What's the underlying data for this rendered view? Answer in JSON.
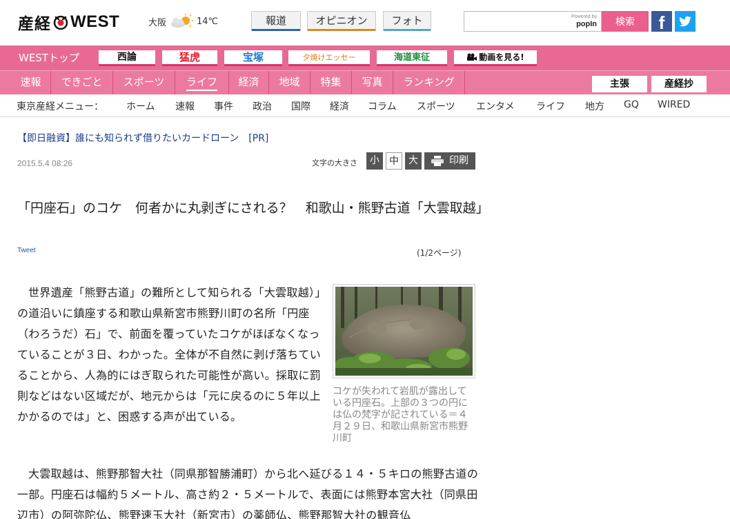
{
  "header": {
    "logo_jp": "産経",
    "logo_en": "WEST",
    "weather": {
      "city": "大阪",
      "icon": "sun-cloud-icon",
      "temp": "14℃"
    },
    "buttons": {
      "news": "報道",
      "opinion": "オピニオン",
      "photo": "フォト"
    },
    "search": {
      "placeholder": "",
      "powered_by": "Powered by",
      "provider": "popIn",
      "button": "検索"
    },
    "social": {
      "facebook": "f",
      "twitter": "twitter-icon"
    }
  },
  "nav": {
    "west_top": "WESTトップ",
    "tags": {
      "seiron": "西論",
      "moko": "猛虎",
      "takarazuka": "宝塚",
      "yuyake": "夕焼けエッセー",
      "kaido": "海道東征",
      "video": "動画を見る!"
    },
    "items": [
      {
        "label": "速報"
      },
      {
        "label": "できごと"
      },
      {
        "label": "スポーツ"
      },
      {
        "label": "ライフ"
      },
      {
        "label": "経済"
      },
      {
        "label": "地域"
      },
      {
        "label": "特集"
      },
      {
        "label": "写真"
      },
      {
        "label": "ランキング"
      }
    ],
    "active": "ライフ",
    "right_tags": {
      "shucho": "主張",
      "sankeisho": "産経抄"
    }
  },
  "tokyo_menu": {
    "label": "東京産経メニュー：",
    "items": [
      "ホーム",
      "速報",
      "事件",
      "政治",
      "国際",
      "経済",
      "コラム",
      "スポーツ",
      "エンタメ",
      "ライフ",
      "地方",
      "GQ",
      "WIRED"
    ]
  },
  "article": {
    "ad": "【即日融資】誰にも知られず借りたいカードローン　[PR]",
    "date": "2015.5.4 08:26",
    "font_size_label": "文字の大きさ",
    "font_sizes": {
      "small": "小",
      "medium": "中",
      "large": "大"
    },
    "print": "印刷",
    "headline": "「円座石」のコケ　何者かに丸剥ぎにされる？　和歌山・熊野古道「大雲取越」",
    "tweet": "Tweet",
    "pages": "(1/2ページ)",
    "caption": "コケが失われて岩肌が露出している円座石。上部の３つの円には仏の梵字が記されている＝４月２９日、和歌山県新宮市熊野川町",
    "paragraph1": "世界遺産「熊野古道」の難所として知られる「大雲取越）」の道沿いに鎮座する和歌山県新宮市熊野川町の名所「円座（わろうだ）石」で、前面を覆っていたコケがほぼなくなっていることが３日、わかった。全体が不自然に剥げ落ちていることから、人為的にはぎ取られた可能性が高い。採取に罰則などはない区域だが、地元からは「元に戻るのに５年以上かかるのでは」と、困惑する声が出ている。",
    "paragraph2": "大雲取越は、熊野那智大社（同県那智勝浦町）から北へ延びる１４・５キロの熊野古道の一部。円座石は幅約５メートル、高さ約２・５メートルで、表面には熊野本宮大社（同県田辺市）の阿弥陀仏、熊野速玉大社（新宮市）の薬師仏、熊野那智大社の観音仏"
  }
}
